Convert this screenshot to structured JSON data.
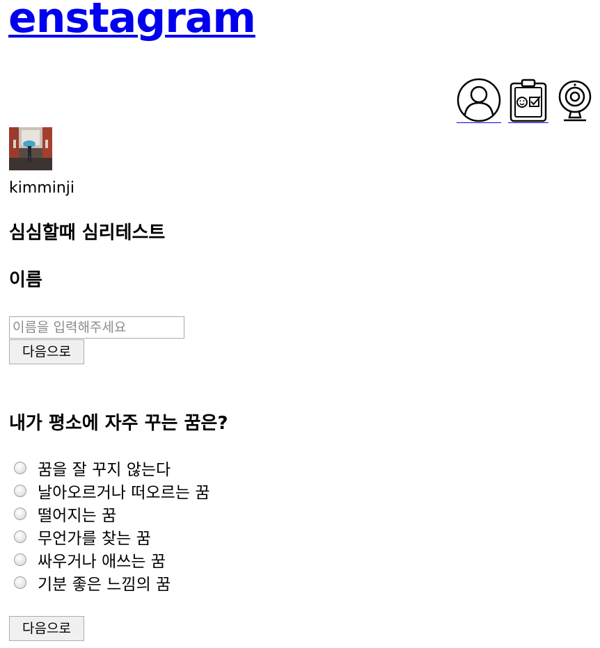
{
  "header": {
    "logo_text": "enstagram",
    "icons": [
      "user-profile-icon",
      "clipboard-check-icon",
      "webcam-icon"
    ]
  },
  "profile": {
    "username": "kimminji"
  },
  "page": {
    "title": "심심할때 심리테스트"
  },
  "name_form": {
    "heading": "이름",
    "input_placeholder": "이름을 입력해주세요",
    "input_value": "",
    "next_label": "다음으로"
  },
  "quiz": {
    "question": "내가 평소에 자주 꾸는 꿈은?",
    "options": [
      "꿈을 잘 꾸지 않는다",
      "날아오르거나 떠오르는 꿈",
      "떨어지는 꿈",
      "무언가를 찾는 꿈",
      "싸우거나 애쓰는 꿈",
      "기분 좋은 느낌의 꿈"
    ],
    "next_label": "다음으로"
  },
  "colors": {
    "link": "#0000ee"
  }
}
